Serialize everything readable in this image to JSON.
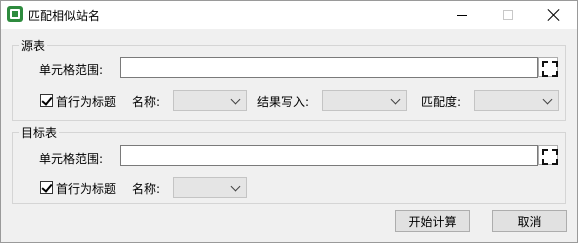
{
  "window": {
    "title": "匹配相似站名",
    "icon": "excel-app-icon"
  },
  "source_group": {
    "title": "源表",
    "range_label": "单元格范围:",
    "range_value": "",
    "first_row_header_label": "首行为标题",
    "first_row_header_checked": true,
    "name_label": "名称:",
    "name_value": "",
    "result_write_label": "结果写入:",
    "result_write_value": "",
    "match_degree_label": "匹配度:",
    "match_degree_value": ""
  },
  "target_group": {
    "title": "目标表",
    "range_label": "单元格范围:",
    "range_value": "",
    "first_row_header_label": "首行为标题",
    "first_row_header_checked": true,
    "name_label": "名称:",
    "name_value": ""
  },
  "buttons": {
    "start_label": "开始计算",
    "cancel_label": "取消"
  }
}
